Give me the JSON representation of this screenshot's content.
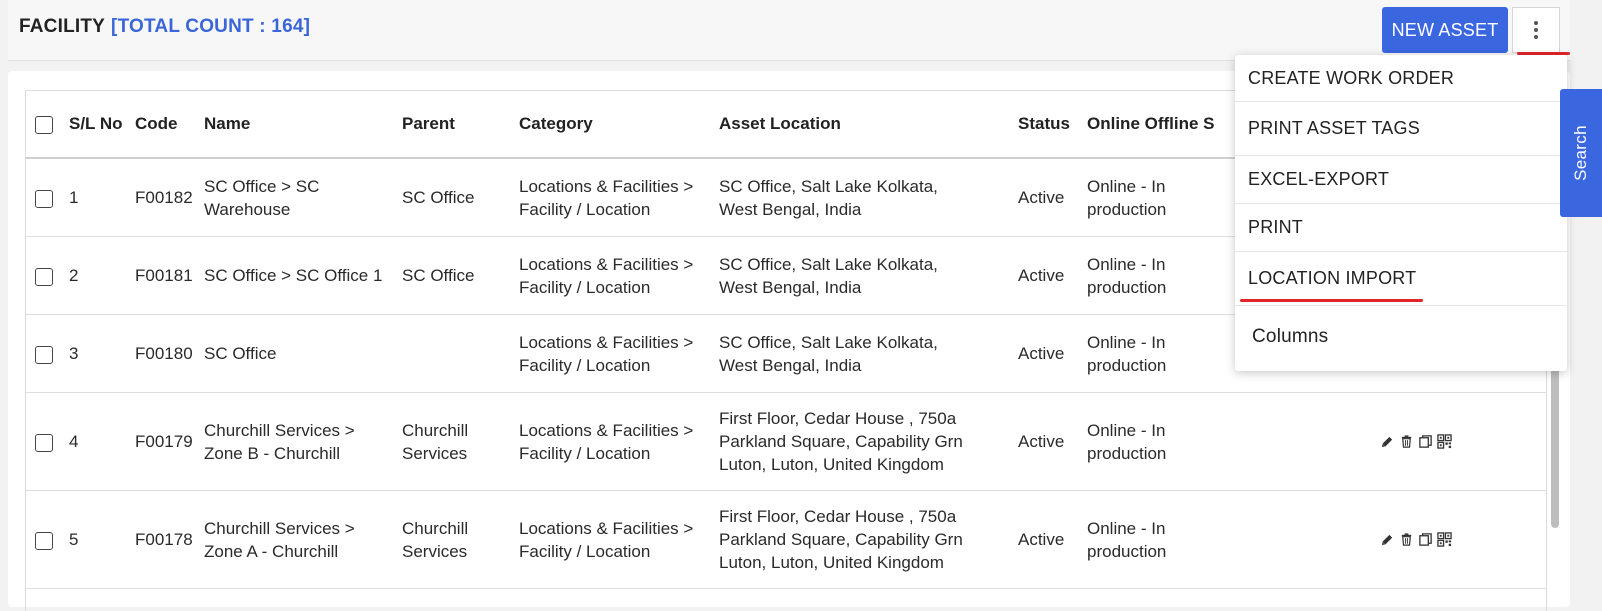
{
  "header": {
    "title": "FACILITY",
    "count_label": "[TOTAL COUNT : 164]",
    "new_asset_label": "NEW ASSET"
  },
  "table": {
    "columns": [
      "S/L No",
      "Code",
      "Name",
      "Parent",
      "Category",
      "Asset Location",
      "Status",
      "Online Offline S"
    ],
    "rows": [
      {
        "sl": "1",
        "code": "F00182",
        "name": "SC Office > SC Warehouse",
        "parent": "SC Office",
        "category": "Locations & Facilities > Facility / Location",
        "location": "SC Office, Salt Lake Kolkata, West Bengal, India",
        "status": "Active",
        "online": "Online - In production"
      },
      {
        "sl": "2",
        "code": "F00181",
        "name": "SC Office > SC Office 1",
        "parent": "SC Office",
        "category": "Locations & Facilities > Facility / Location",
        "location": "SC Office, Salt Lake Kolkata, West Bengal, India",
        "status": "Active",
        "online": "Online - In production"
      },
      {
        "sl": "3",
        "code": "F00180",
        "name": "SC Office",
        "parent": "",
        "category": "Locations & Facilities > Facility / Location",
        "location": "SC Office, Salt Lake Kolkata, West Bengal, India",
        "status": "Active",
        "online": "Online - In production"
      },
      {
        "sl": "4",
        "code": "F00179",
        "name": "Churchill Services > Zone B - Churchill",
        "parent": "Churchill Services",
        "category": "Locations & Facilities > Facility / Location",
        "location": "First Floor, Cedar House , 750a Parkland Square, Capability Grn Luton, Luton, United Kingdom",
        "status": "Active",
        "online": "Online - In production"
      },
      {
        "sl": "5",
        "code": "F00178",
        "name": "Churchill Services > Zone A - Churchill",
        "parent": "Churchill Services",
        "category": "Locations & Facilities > Facility / Location",
        "location": "First Floor, Cedar House , 750a Parkland Square, Capability Grn Luton, Luton, United Kingdom",
        "status": "Active",
        "online": "Online - In production"
      }
    ]
  },
  "menu": {
    "items": [
      "CREATE WORK ORDER",
      "PRINT ASSET TAGS",
      "EXCEL-EXPORT",
      "PRINT",
      "LOCATION IMPORT",
      "Columns"
    ]
  },
  "search_tab": {
    "label": "Search"
  },
  "colors": {
    "accent": "#3a66e0",
    "highlight_underline": "#e0252b"
  },
  "icons": [
    "edit-icon",
    "delete-icon",
    "copy-icon",
    "qr-code-icon",
    "kebab-menu-icon"
  ]
}
